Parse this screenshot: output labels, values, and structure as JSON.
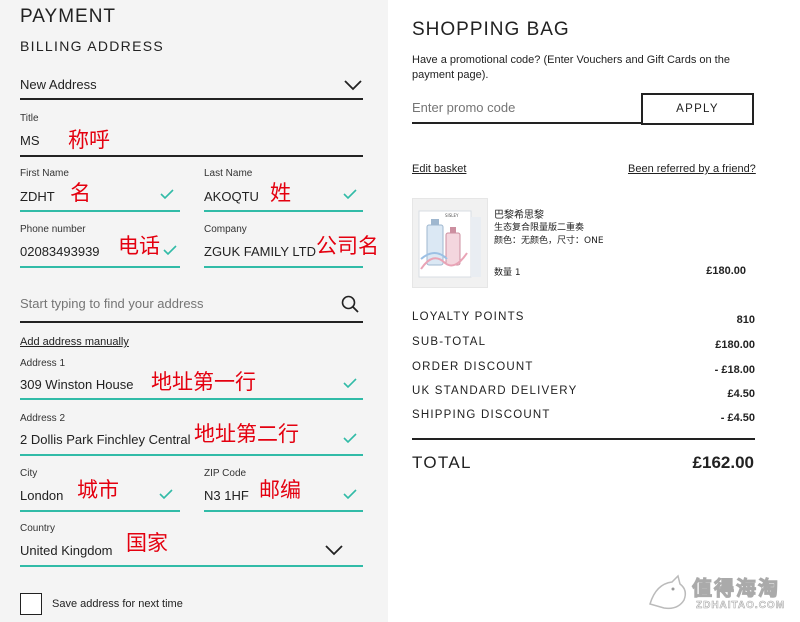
{
  "payment": {
    "title": "PAYMENT",
    "billing_title": "BILLING ADDRESS",
    "address_select": "New Address",
    "title_field": {
      "label": "Title",
      "value": "MS",
      "annotation": "称呼"
    },
    "first_name": {
      "label": "First Name",
      "value": "ZDHT",
      "annotation": "名"
    },
    "last_name": {
      "label": "Last Name",
      "value": "AKOQTU",
      "annotation": "姓"
    },
    "phone": {
      "label": "Phone number",
      "value": "02083493939",
      "annotation": "电话"
    },
    "company": {
      "label": "Company",
      "value": "ZGUK FAMILY LTD",
      "annotation": "公司名"
    },
    "address_search": {
      "placeholder": "Start typing to find your address"
    },
    "add_manually": "Add address manually",
    "address1": {
      "label": "Address 1",
      "value": "309 Winston House",
      "annotation": "地址第一行"
    },
    "address2": {
      "label": "Address 2",
      "value": "2 Dollis Park Finchley Central",
      "annotation": "地址第二行"
    },
    "city": {
      "label": "City",
      "value": "London",
      "annotation": "城市"
    },
    "zip": {
      "label": "ZIP Code",
      "value": "N3 1HF",
      "annotation": "邮编"
    },
    "country": {
      "label": "Country",
      "value": "United Kingdom",
      "annotation": "国家"
    },
    "save_address": "Save address for next time"
  },
  "bag": {
    "title": "SHOPPING BAG",
    "promo_text": "Have a promotional code? (Enter Vouchers and Gift Cards on the payment page).",
    "promo_placeholder": "Enter promo code",
    "apply": "APPLY",
    "edit_basket": "Edit basket",
    "referred": "Been referred by a friend?",
    "product": {
      "brand": "巴黎希思黎",
      "name": "生态复合限量版二重奏",
      "variant": "颜色：无颜色，尺寸：ONE",
      "qty": "数量 1",
      "price": "£180.00"
    },
    "summary": [
      {
        "label": "LOYALTY POINTS",
        "value": "810"
      },
      {
        "label": "SUB-TOTAL",
        "value": "£180.00"
      },
      {
        "label": "ORDER DISCOUNT",
        "value": "- £18.00"
      },
      {
        "label": "UK STANDARD DELIVERY",
        "value": "£4.50"
      },
      {
        "label": "SHIPPING DISCOUNT",
        "value": "- £4.50"
      }
    ],
    "total_label": "TOTAL",
    "total_value": "£162.00"
  },
  "watermark": {
    "cn": "值得海淘",
    "en": "ZDHAITAO.COM"
  },
  "colors": {
    "accent_teal": "#31bba7",
    "annotation_red": "#e4000f",
    "left_bg": "#f4f4f4"
  }
}
